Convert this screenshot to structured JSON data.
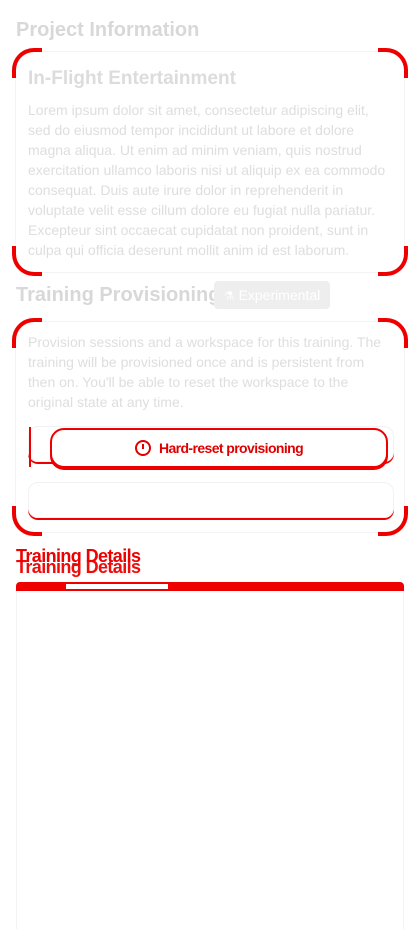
{
  "project": {
    "title": "Project Information",
    "card": {
      "title": "In-Flight Entertainment",
      "body": "Lorem ipsum dolor sit amet, consectetur adipiscing elit, sed do eiusmod tempor incididunt ut labore et dolore magna aliqua. Ut enim ad minim veniam, quis nostrud exercitation ullamco laboris nisi ut aliquip ex ea commodo consequat. Duis aute irure dolor in reprehenderit in voluptate velit esse cillum dolore eu fugiat nulla pariatur. Excepteur sint occaecat cupidatat non proident, sunt in culpa qui officia deserunt mollit anim id est laborum."
    }
  },
  "provisioning": {
    "title": "Training Provisioning",
    "badge": "Experimental",
    "badge_icon": "flask-icon",
    "body": "Provision sessions and a workspace for this training. The training will be provisioned once and is persistent from then on. You'll be able to reset the workspace to the original state at any time.",
    "reset_button": "Hard-reset provisioning",
    "reset_icon": "power-reset-icon"
  },
  "details": {
    "title": "Training Details"
  },
  "colors": {
    "accent": "#ee0000",
    "muted_text": "#dcdcdc"
  }
}
